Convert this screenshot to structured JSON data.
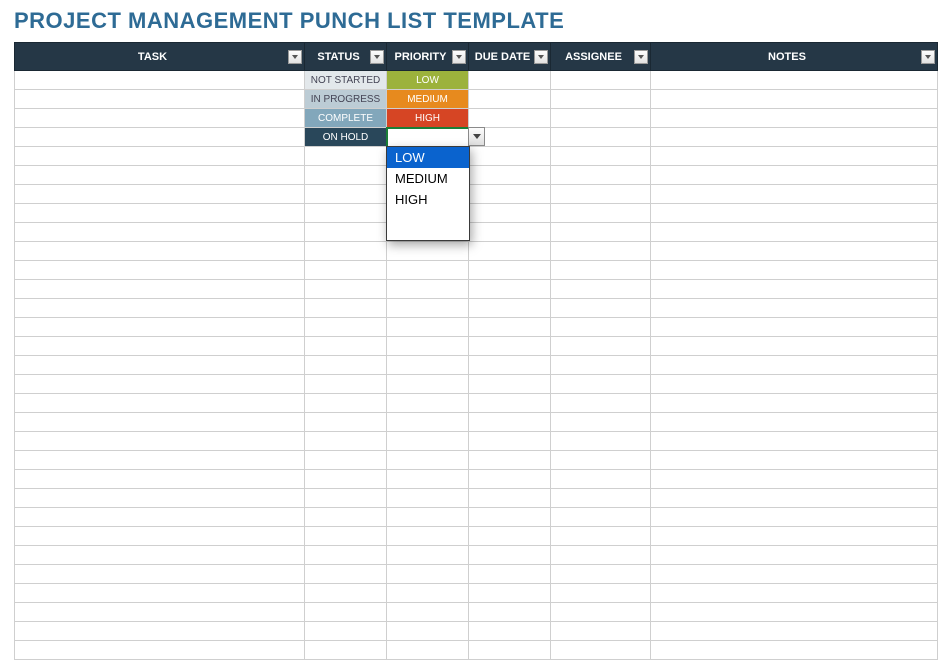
{
  "title": "PROJECT MANAGEMENT PUNCH LIST TEMPLATE",
  "columns": {
    "task": "TASK",
    "status": "STATUS",
    "priority": "PRIORITY",
    "due": "DUE DATE",
    "assignee": "ASSIGNEE",
    "notes": "NOTES"
  },
  "status_options": [
    "NOT STARTED",
    "IN PROGRESS",
    "COMPLETE",
    "ON HOLD"
  ],
  "priority_options": [
    "LOW",
    "MEDIUM",
    "HIGH"
  ],
  "filled_rows": [
    {
      "status": "NOT STARTED",
      "status_class": "status-notstarted",
      "priority": "LOW",
      "priority_class": "priority-low"
    },
    {
      "status": "IN PROGRESS",
      "status_class": "status-inprogress",
      "priority": "MEDIUM",
      "priority_class": "priority-medium"
    },
    {
      "status": "COMPLETE",
      "status_class": "status-complete",
      "priority": "HIGH",
      "priority_class": "priority-high"
    },
    {
      "status": "ON HOLD",
      "status_class": "status-onhold",
      "priority": "",
      "priority_class": ""
    }
  ],
  "dropdown": {
    "selected": "LOW",
    "options": [
      "LOW",
      "MEDIUM",
      "HIGH"
    ]
  },
  "colors": {
    "header_bg": "#253746",
    "title_color": "#2e6b95",
    "selection_green": "#1a7f37",
    "dropdown_highlight": "#0a63ce"
  },
  "empty_row_count": 27
}
